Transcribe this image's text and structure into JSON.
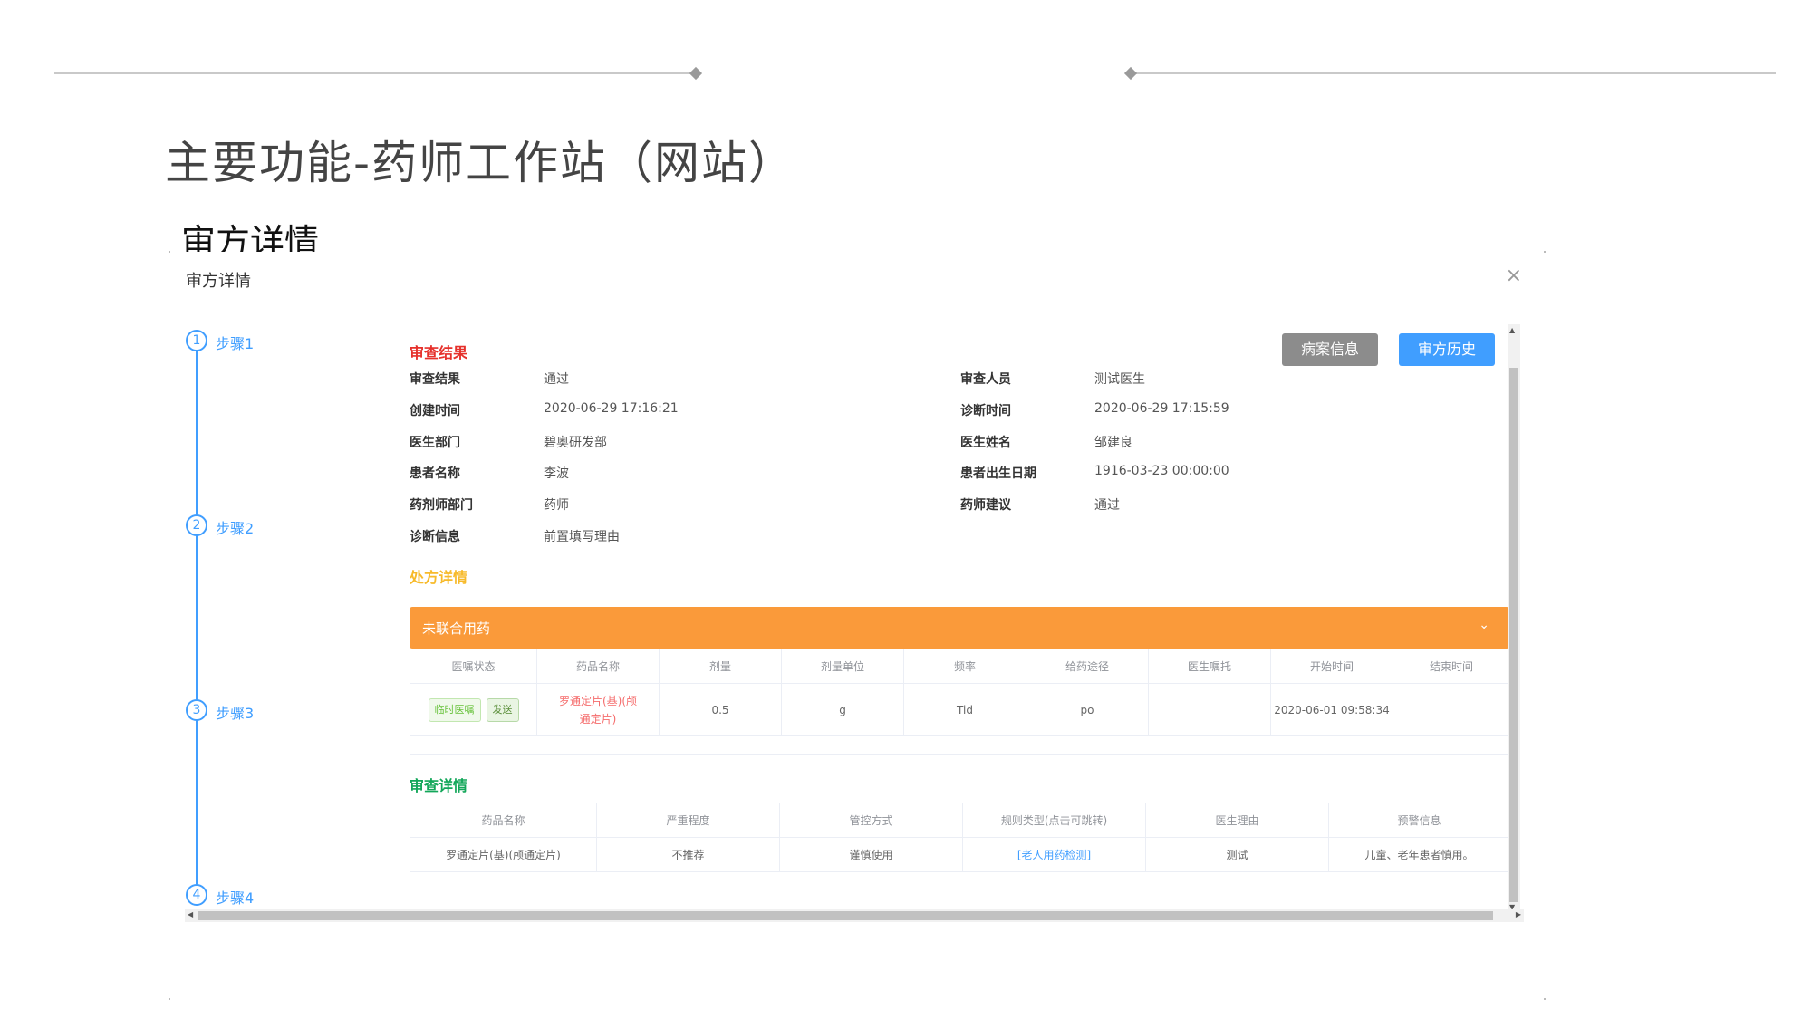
{
  "slide": {
    "title": "主要功能-药师工作站（网站）",
    "section_heading": "审方详情"
  },
  "dialog": {
    "title": "审方详情",
    "close_icon": "×"
  },
  "steps": [
    {
      "num": "1",
      "label": "步骤1"
    },
    {
      "num": "2",
      "label": "步骤2"
    },
    {
      "num": "3",
      "label": "步骤3"
    },
    {
      "num": "4",
      "label": "步骤4"
    }
  ],
  "review_result": {
    "section_title": "审查结果",
    "buttons": {
      "case_info": "病案信息",
      "review_history": "审方历史"
    },
    "left": [
      {
        "label": "审查结果",
        "value": "通过"
      },
      {
        "label": "创建时间",
        "value": "2020-06-29 17:16:21"
      },
      {
        "label": "医生部门",
        "value": "碧奥研发部"
      },
      {
        "label": "患者名称",
        "value": "李波"
      },
      {
        "label": "药剂师部门",
        "value": "药师"
      },
      {
        "label": "诊断信息",
        "value": "前置填写理由"
      }
    ],
    "right": [
      {
        "label": "审查人员",
        "value": "测试医生"
      },
      {
        "label": "诊断时间",
        "value": "2020-06-29 17:15:59"
      },
      {
        "label": "医生姓名",
        "value": "邹建良"
      },
      {
        "label": "患者出生日期",
        "value": "1916-03-23 00:00:00"
      },
      {
        "label": "药师建议",
        "value": "通过"
      }
    ]
  },
  "prescription": {
    "section_title": "处方详情",
    "group_title": "未联合用药",
    "headers": [
      "医嘱状态",
      "药品名称",
      "剂量",
      "剂量单位",
      "频率",
      "给药途径",
      "医生嘱托",
      "开始时间",
      "结束时间"
    ],
    "row": {
      "tags": [
        "临时医嘱",
        "发送"
      ],
      "drug": "罗通定片(基)(颅通定片)",
      "dose": "0.5",
      "unit": "g",
      "freq": "Tid",
      "route": "po",
      "advice": "",
      "start": "2020-06-01 09:58:34",
      "end": ""
    }
  },
  "review_detail": {
    "section_title": "审查详情",
    "headers": [
      "药品名称",
      "严重程度",
      "管控方式",
      "规则类型(点击可跳转)",
      "医生理由",
      "预警信息"
    ],
    "row": {
      "drug": "罗通定片(基)(颅通定片)",
      "severity": "不推荐",
      "control": "谨慎使用",
      "rule": "[老人用药检测]",
      "reason": "测试",
      "warning": "儿童、老年患者慎用。"
    }
  },
  "colors": {
    "primary": "#409eff",
    "danger": "#e6302b",
    "warning": "#f7ba2a",
    "success": "#13a75a",
    "orange": "#fa9a3a",
    "gray_button": "#8c8c8c"
  }
}
